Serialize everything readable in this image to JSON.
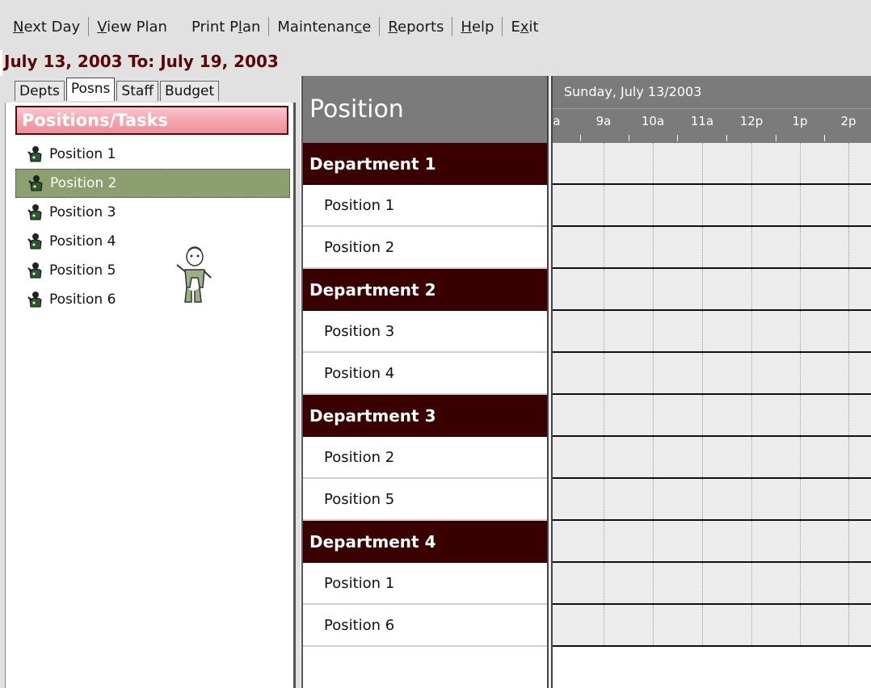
{
  "menu": [
    {
      "label": "Next Day",
      "access": "N"
    },
    {
      "label": "View Plan",
      "access": "V"
    },
    {
      "label": "Print Plan",
      "access": "l"
    },
    {
      "label": "Maintenance",
      "access": "g"
    },
    {
      "label": "Reports",
      "access": "R"
    },
    {
      "label": "Help",
      "access": "H"
    },
    {
      "label": "Exit",
      "access": "x"
    }
  ],
  "date_range": "July 13, 2003 To: July 19, 2003",
  "tabs": [
    {
      "label": "Depts",
      "active": false
    },
    {
      "label": "Posns",
      "active": true
    },
    {
      "label": "Staff",
      "active": false
    },
    {
      "label": "Budget",
      "active": false
    }
  ],
  "list_header": "Positions/Tasks",
  "positions": [
    {
      "label": "Position 1",
      "selected": false
    },
    {
      "label": "Position 2",
      "selected": true
    },
    {
      "label": "Position 3",
      "selected": false
    },
    {
      "label": "Position 4",
      "selected": false
    },
    {
      "label": "Position 5",
      "selected": false
    },
    {
      "label": "Position 6",
      "selected": false
    }
  ],
  "schedule": {
    "column_header": "Position",
    "day_label": "Sunday, July 13/2003",
    "time_labels": [
      "a",
      "9a",
      "10a",
      "11a",
      "12p",
      "1p",
      "2p"
    ],
    "rows": [
      {
        "type": "dept",
        "label": "Department 1"
      },
      {
        "type": "pos",
        "label": "Position 1"
      },
      {
        "type": "pos",
        "label": "Position 2"
      },
      {
        "type": "dept",
        "label": "Department 2"
      },
      {
        "type": "pos",
        "label": "Position 3"
      },
      {
        "type": "pos",
        "label": "Position 4"
      },
      {
        "type": "dept",
        "label": "Department 3"
      },
      {
        "type": "pos",
        "label": "Position 2"
      },
      {
        "type": "pos",
        "label": "Position 5"
      },
      {
        "type": "dept",
        "label": "Department 4"
      },
      {
        "type": "pos",
        "label": "Position 1"
      },
      {
        "type": "pos",
        "label": "Position 6"
      }
    ]
  },
  "colors": {
    "menu_bg": "#e1e1e1",
    "date_text": "#5a0606",
    "dept_row": "#3a0000",
    "selected_item": "#8d9f6e",
    "header_gray": "#7b7b7b",
    "list_header_pink": "#f3a3ad"
  },
  "icons": {
    "position_item": "worker-icon",
    "drag_cursor": "worker-drag-cursor-icon"
  }
}
